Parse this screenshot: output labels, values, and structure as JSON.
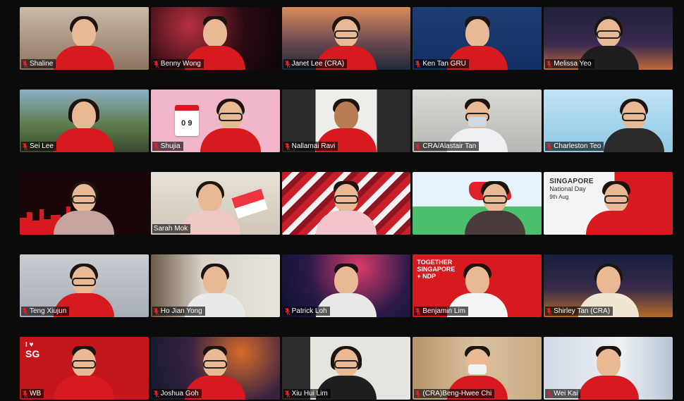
{
  "app": "video-call-gallery-view",
  "colors": {
    "stage": "#0b0b0b",
    "mute_red": "#e0222a",
    "shirt_red": "#d71920",
    "active_speaker_outline": "#d7e64a"
  },
  "participants": [
    {
      "name": "Shaline",
      "muted": true
    },
    {
      "name": "Benny Wong",
      "muted": true
    },
    {
      "name": "Janet Lee (CRA)",
      "muted": true
    },
    {
      "name": "Ken Tan GRU",
      "muted": true
    },
    {
      "name": "Melissa Yeo",
      "muted": true
    },
    {
      "name": "Sei Lee",
      "muted": true
    },
    {
      "name": "Shujia",
      "muted": true
    },
    {
      "name": "Nallamai Ravi",
      "muted": true
    },
    {
      "name": "CRA/Alastair Tan",
      "muted": true
    },
    {
      "name": "Charleston Teo",
      "muted": true
    },
    {
      "name": "",
      "muted": false
    },
    {
      "name": "Sarah Mok",
      "muted": false,
      "active_speaker": true
    },
    {
      "name": "",
      "muted": false
    },
    {
      "name": "",
      "muted": false
    },
    {
      "name": "",
      "muted": false
    },
    {
      "name": "Teng Xiujun",
      "muted": true
    },
    {
      "name": "Ho Jian Yong",
      "muted": true
    },
    {
      "name": "Patrick Loh",
      "muted": true
    },
    {
      "name": "Benjamin Lim",
      "muted": true
    },
    {
      "name": "Shirley Tan (CRA)",
      "muted": true
    },
    {
      "name": "WB",
      "muted": true
    },
    {
      "name": "Joshua Goh",
      "muted": true
    },
    {
      "name": "Xiu Hui Lim",
      "muted": true
    },
    {
      "name": "(CRA)Beng-Hwee Chi",
      "muted": true
    },
    {
      "name": "Wei Kai",
      "muted": true
    }
  ],
  "background_text": {
    "tile_7_calendar": "0 9",
    "tile_15_poster_title": "SINGAPORE",
    "tile_15_poster_subtitle": "National Day",
    "tile_15_poster_date": "9th Aug",
    "tile_19_banner_line1": "TOGETHER",
    "tile_19_banner_line2": "SINGAPORE",
    "tile_19_banner_line3": "+ NDP",
    "tile_21_logo_top": "I ♥",
    "tile_21_logo_bottom": "SG"
  }
}
